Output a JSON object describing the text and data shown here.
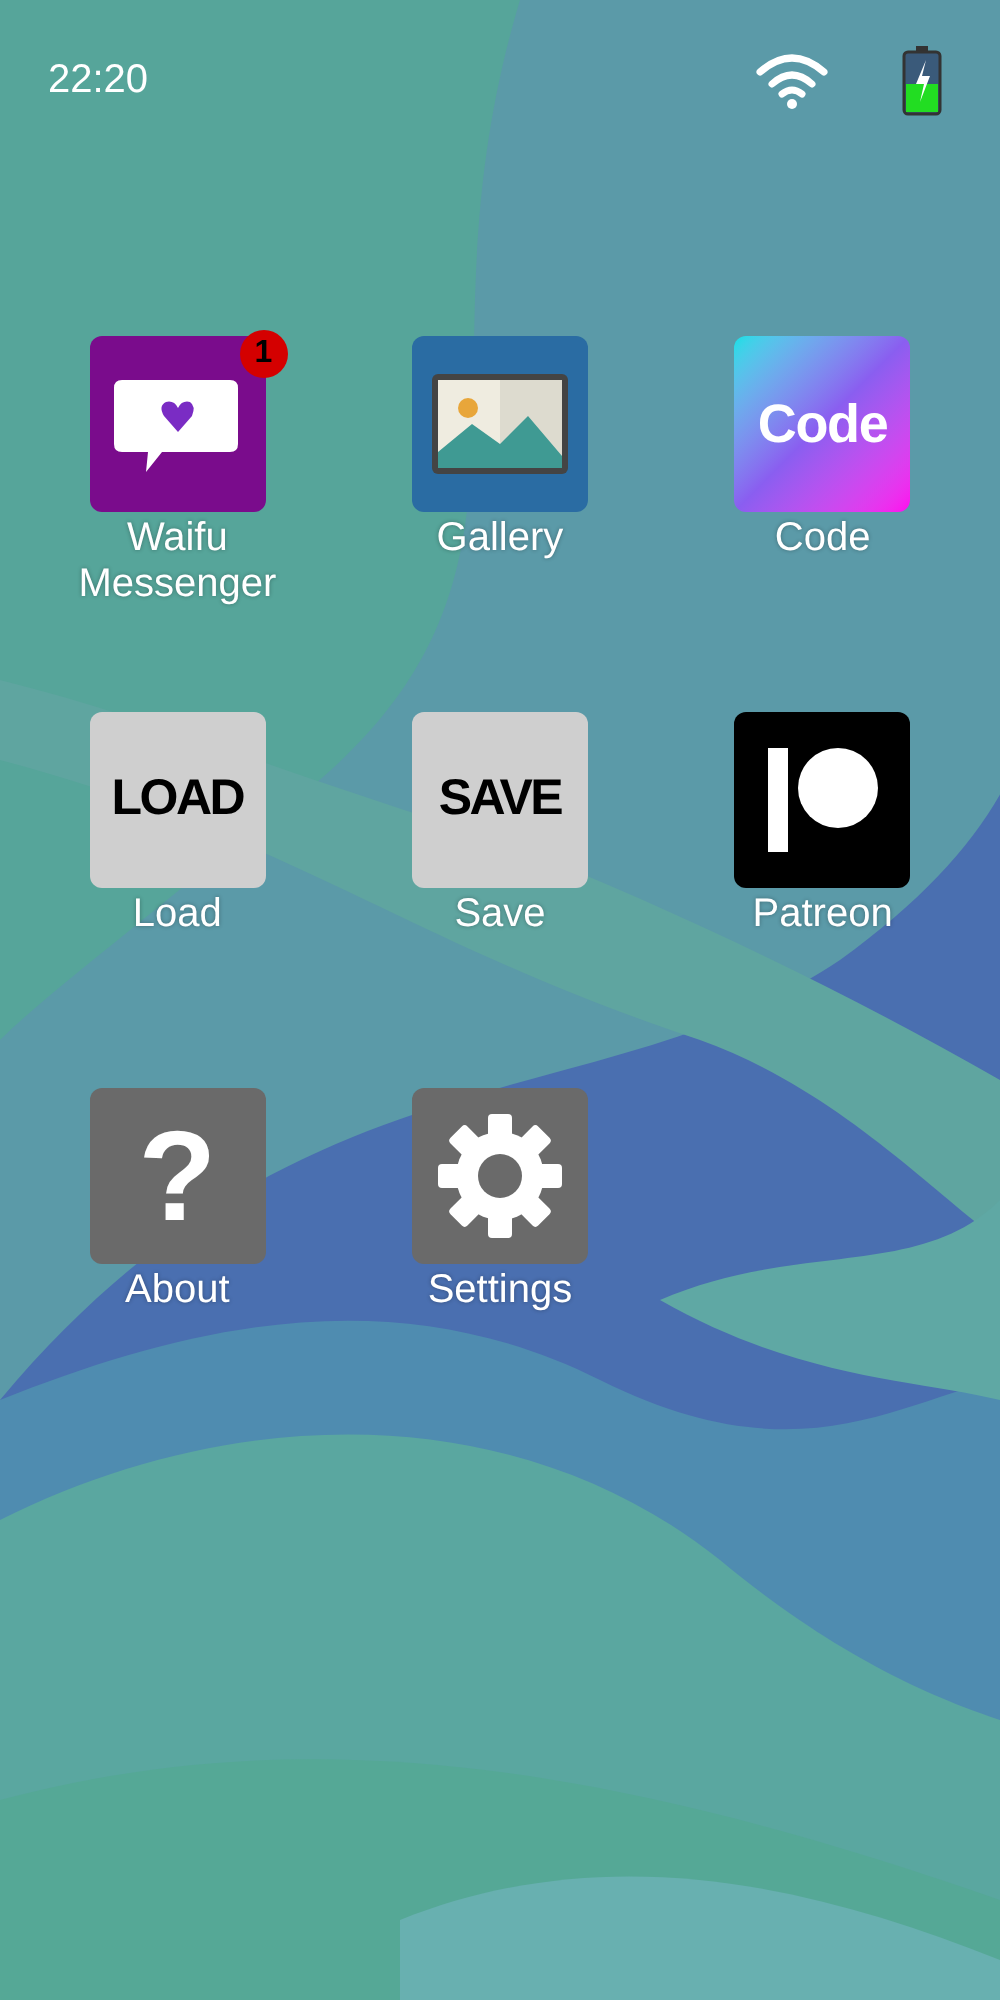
{
  "status_bar": {
    "time": "22:20"
  },
  "apps": [
    {
      "label": "Waifu Messenger",
      "icon": {
        "kind": "messenger"
      },
      "badge": "1"
    },
    {
      "label": "Gallery",
      "icon": {
        "kind": "gallery"
      }
    },
    {
      "label": "Code",
      "icon": {
        "kind": "code",
        "text": "Code"
      }
    },
    {
      "label": "Load",
      "icon": {
        "kind": "load",
        "text": "LOAD"
      }
    },
    {
      "label": "Save",
      "icon": {
        "kind": "save",
        "text": "SAVE"
      }
    },
    {
      "label": "Patreon",
      "icon": {
        "kind": "patreon"
      }
    },
    {
      "label": "About",
      "icon": {
        "kind": "about",
        "text": "?"
      }
    },
    {
      "label": "Settings",
      "icon": {
        "kind": "settings"
      }
    }
  ]
}
